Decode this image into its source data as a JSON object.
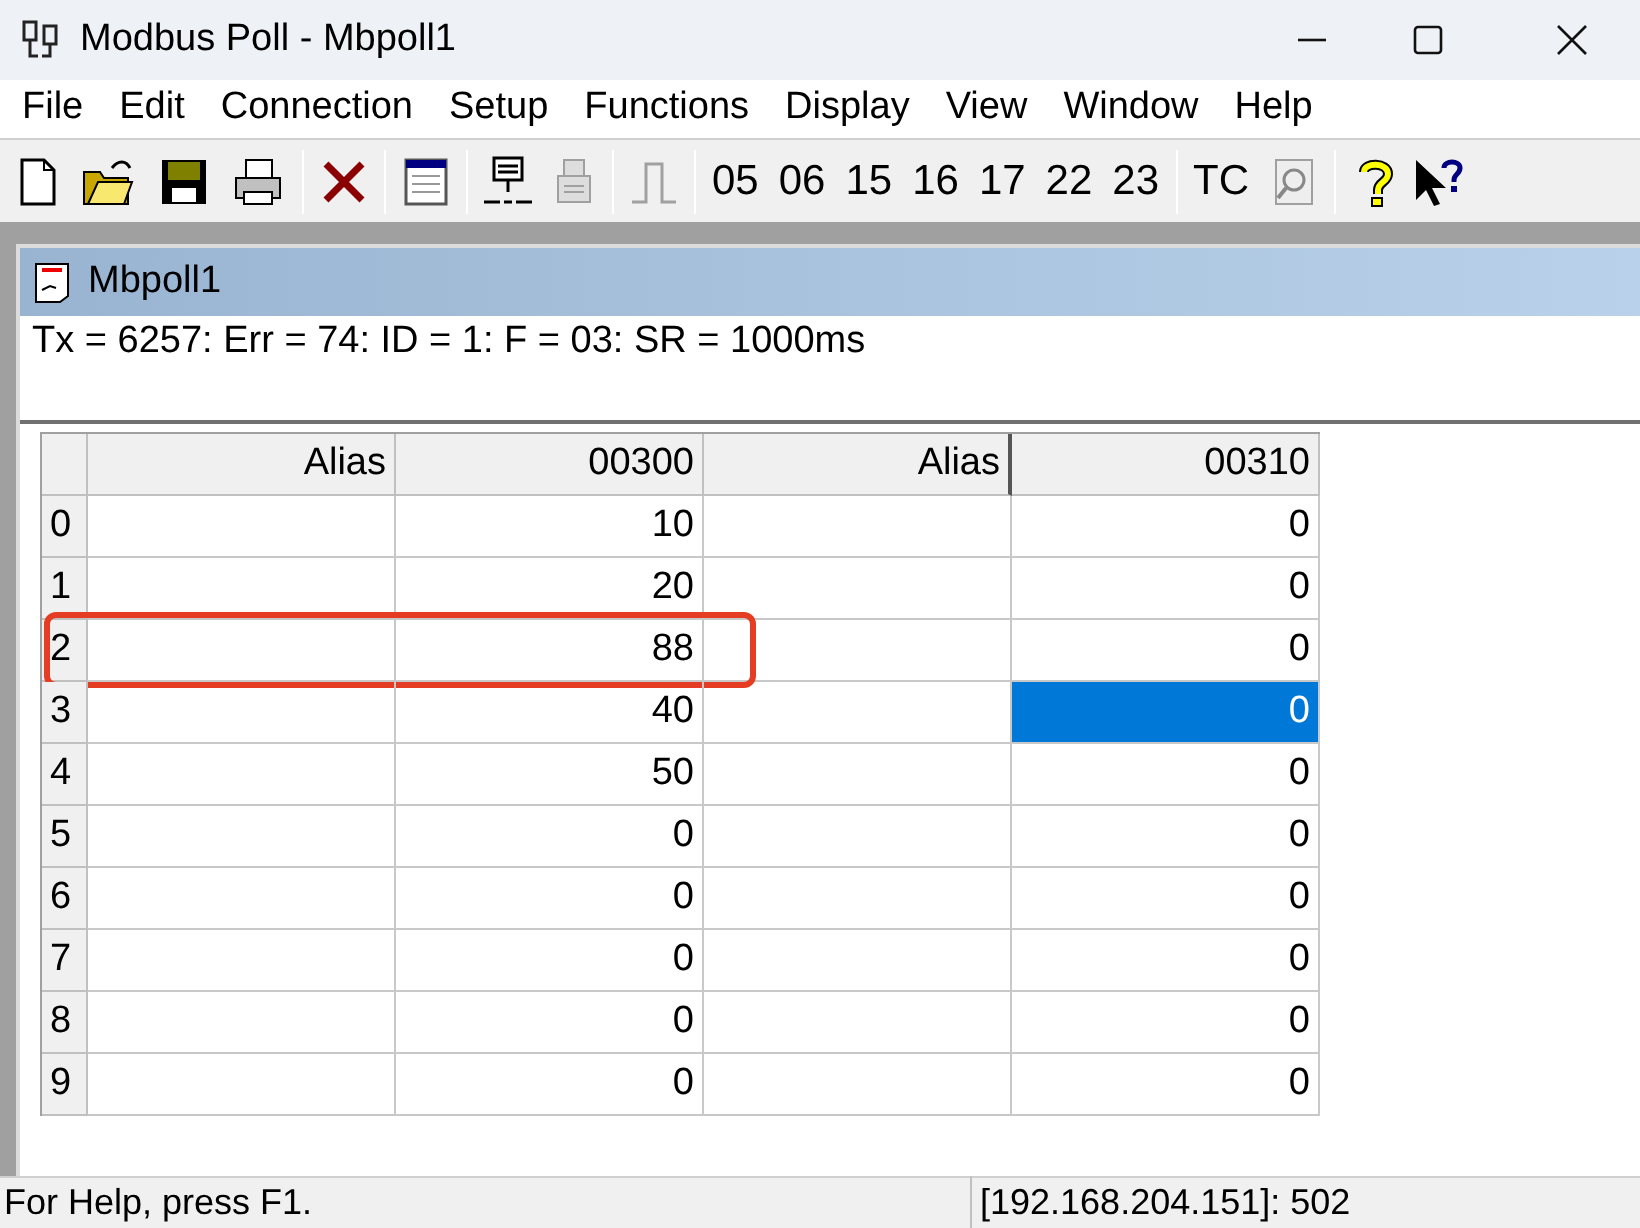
{
  "window": {
    "title": "Modbus Poll - Mbpoll1"
  },
  "menu": [
    "File",
    "Edit",
    "Connection",
    "Setup",
    "Functions",
    "Display",
    "View",
    "Window",
    "Help"
  ],
  "toolbar_codes": [
    "05",
    "06",
    "15",
    "16",
    "17",
    "22",
    "23",
    "TC"
  ],
  "child": {
    "title": "Mbpoll1",
    "status_line": "Tx = 6257: Err = 74: ID = 1: F = 03: SR = 1000ms"
  },
  "table": {
    "columns": [
      "",
      "Alias",
      "00300",
      "Alias",
      "00310"
    ],
    "rows": [
      {
        "highlighted": false,
        "cells": [
          {
            "text": "0",
            "selected": false
          },
          {
            "text": "",
            "selected": false
          },
          {
            "text": "10",
            "selected": false
          },
          {
            "text": "",
            "selected": false
          },
          {
            "text": "0",
            "selected": false
          }
        ]
      },
      {
        "highlighted": false,
        "cells": [
          {
            "text": "1",
            "selected": false
          },
          {
            "text": "",
            "selected": false
          },
          {
            "text": "20",
            "selected": false
          },
          {
            "text": "",
            "selected": false
          },
          {
            "text": "0",
            "selected": false
          }
        ]
      },
      {
        "highlighted": true,
        "cells": [
          {
            "text": "2",
            "selected": false
          },
          {
            "text": "",
            "selected": false
          },
          {
            "text": "88",
            "selected": false
          },
          {
            "text": "",
            "selected": false
          },
          {
            "text": "0",
            "selected": false
          }
        ]
      },
      {
        "highlighted": false,
        "cells": [
          {
            "text": "3",
            "selected": false
          },
          {
            "text": "",
            "selected": false
          },
          {
            "text": "40",
            "selected": false
          },
          {
            "text": "",
            "selected": false
          },
          {
            "text": "0",
            "selected": true
          }
        ]
      },
      {
        "highlighted": false,
        "cells": [
          {
            "text": "4",
            "selected": false
          },
          {
            "text": "",
            "selected": false
          },
          {
            "text": "50",
            "selected": false
          },
          {
            "text": "",
            "selected": false
          },
          {
            "text": "0",
            "selected": false
          }
        ]
      },
      {
        "highlighted": false,
        "cells": [
          {
            "text": "5",
            "selected": false
          },
          {
            "text": "",
            "selected": false
          },
          {
            "text": "0",
            "selected": false
          },
          {
            "text": "",
            "selected": false
          },
          {
            "text": "0",
            "selected": false
          }
        ]
      },
      {
        "highlighted": false,
        "cells": [
          {
            "text": "6",
            "selected": false
          },
          {
            "text": "",
            "selected": false
          },
          {
            "text": "0",
            "selected": false
          },
          {
            "text": "",
            "selected": false
          },
          {
            "text": "0",
            "selected": false
          }
        ]
      },
      {
        "highlighted": false,
        "cells": [
          {
            "text": "7",
            "selected": false
          },
          {
            "text": "",
            "selected": false
          },
          {
            "text": "0",
            "selected": false
          },
          {
            "text": "",
            "selected": false
          },
          {
            "text": "0",
            "selected": false
          }
        ]
      },
      {
        "highlighted": false,
        "cells": [
          {
            "text": "8",
            "selected": false
          },
          {
            "text": "",
            "selected": false
          },
          {
            "text": "0",
            "selected": false
          },
          {
            "text": "",
            "selected": false
          },
          {
            "text": "0",
            "selected": false
          }
        ]
      },
      {
        "highlighted": false,
        "cells": [
          {
            "text": "9",
            "selected": false
          },
          {
            "text": "",
            "selected": false
          },
          {
            "text": "0",
            "selected": false
          },
          {
            "text": "",
            "selected": false
          },
          {
            "text": "0",
            "selected": false
          }
        ]
      }
    ]
  },
  "status_bar": {
    "help": "For Help, press F1.",
    "connection": "[192.168.204.151]: 502"
  }
}
